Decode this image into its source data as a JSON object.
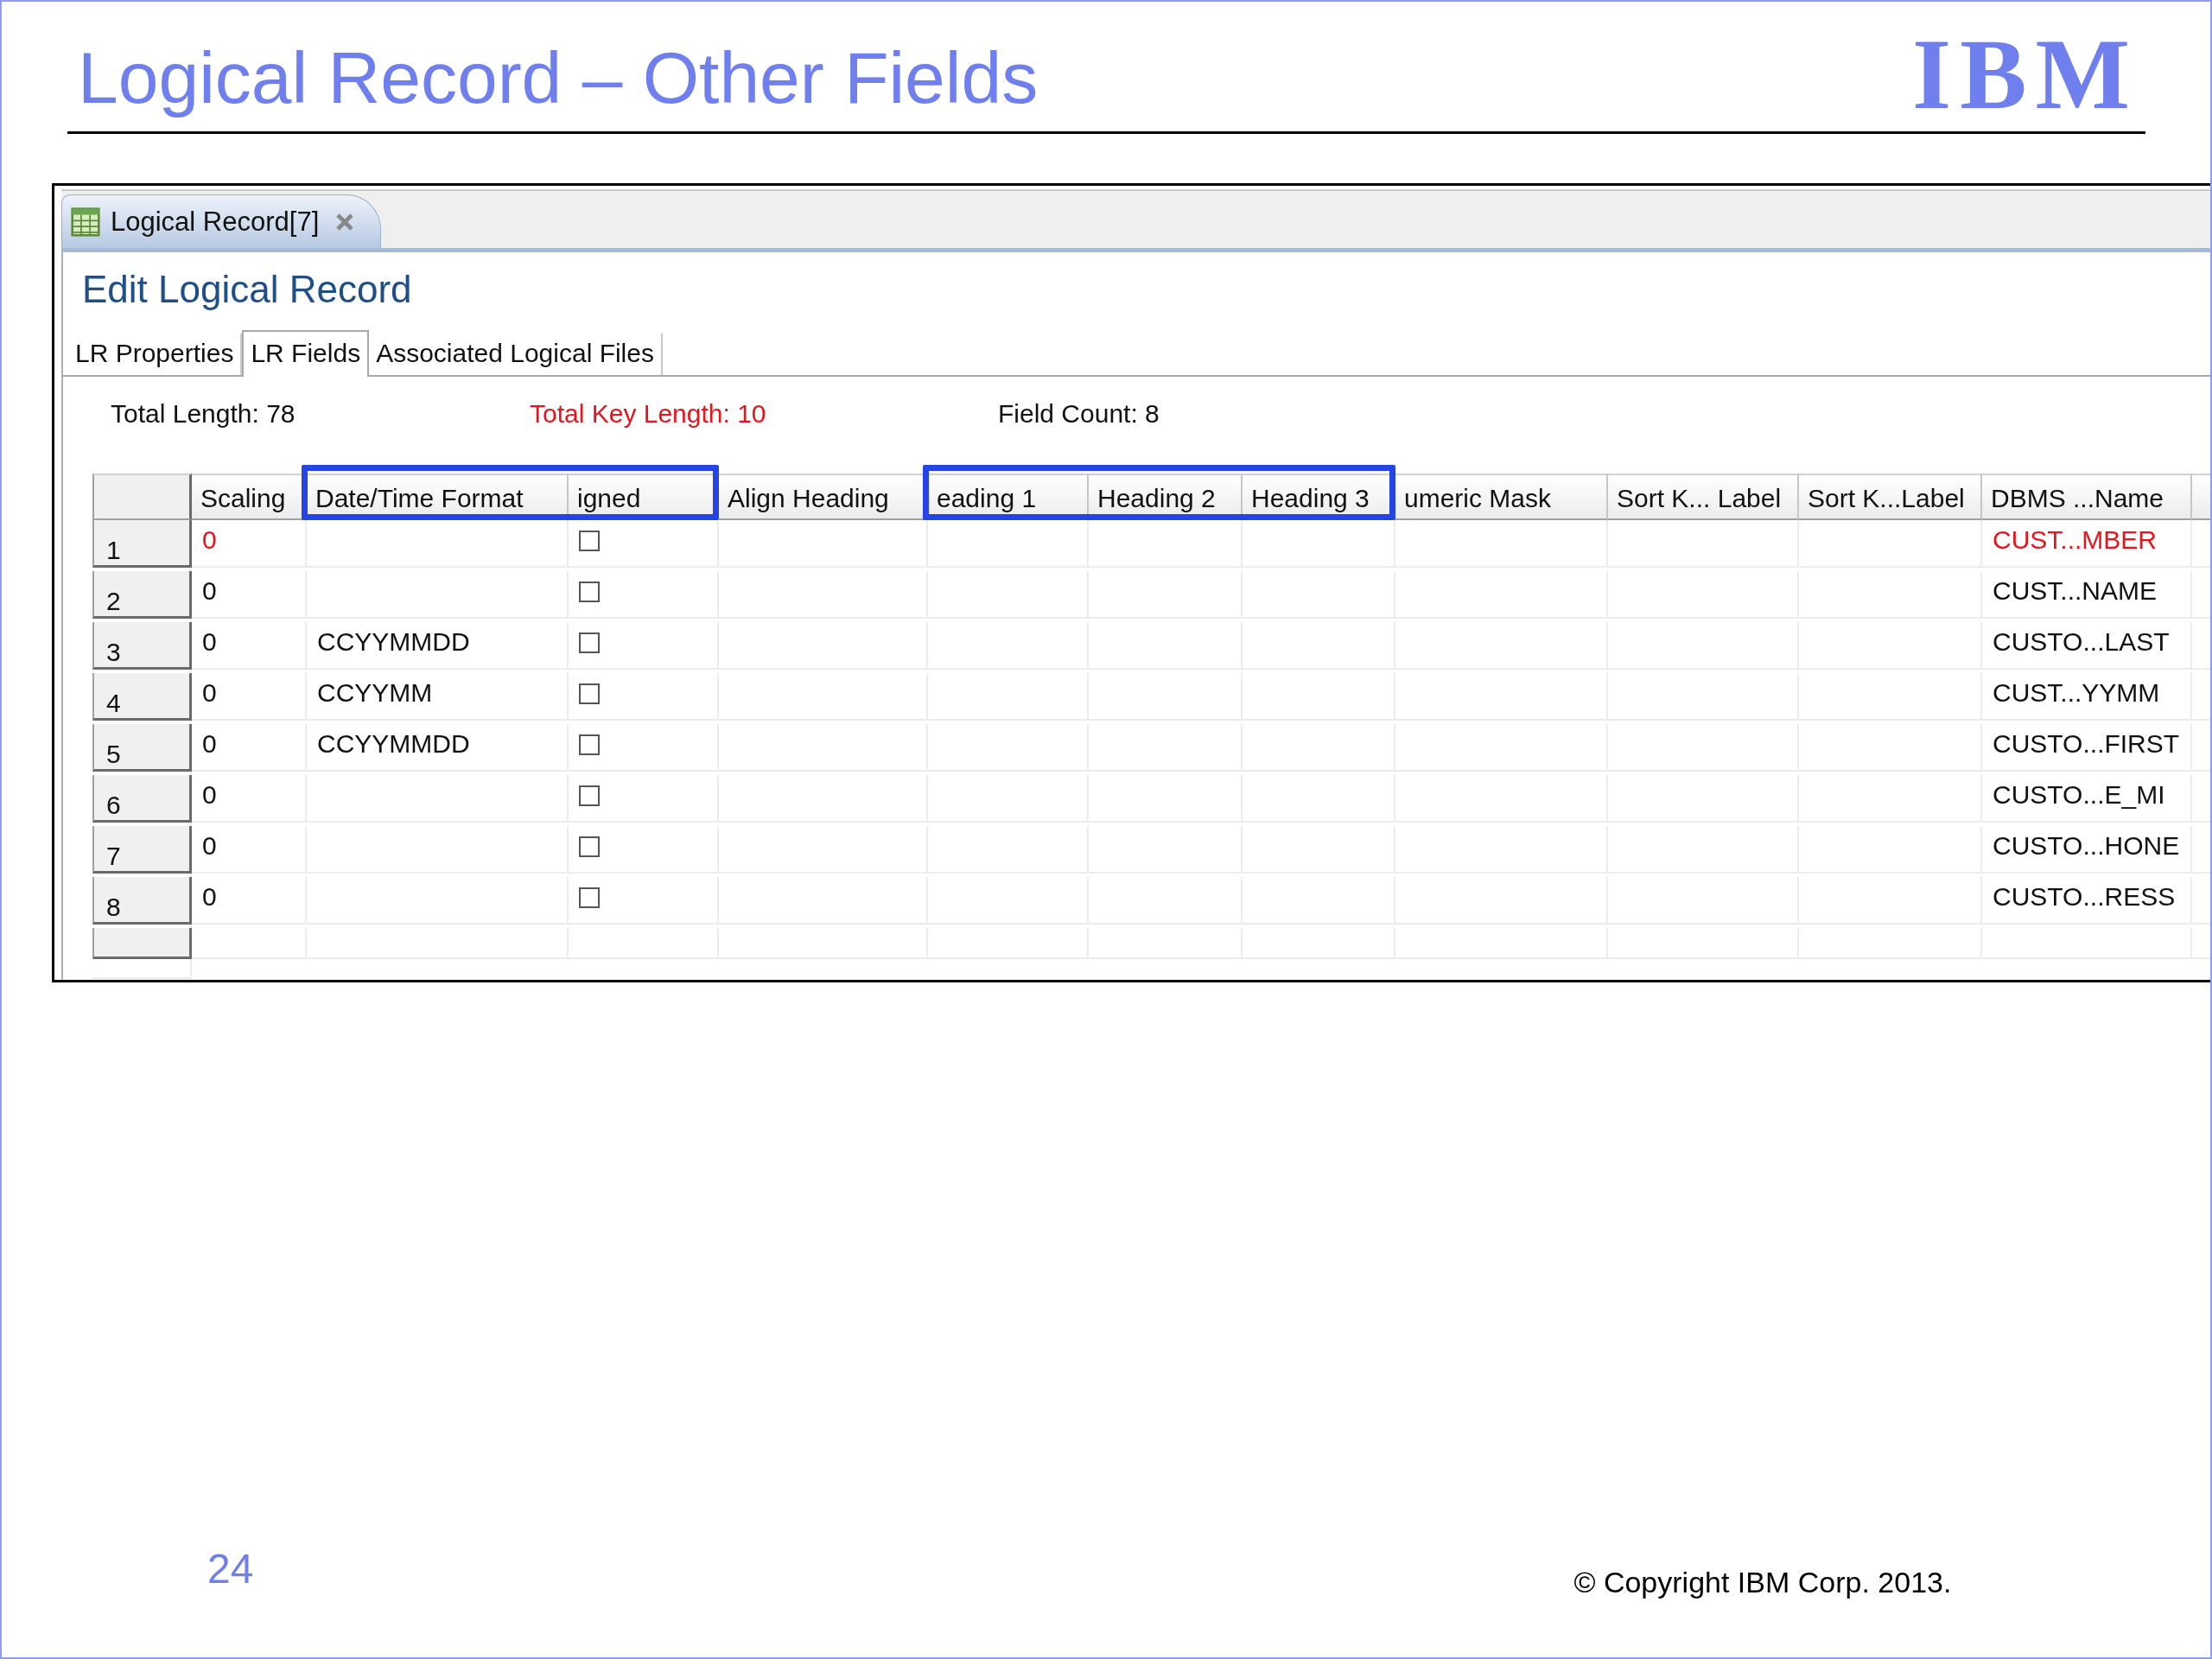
{
  "slide": {
    "title": "Logical Record – Other Fields",
    "logo": "IBM",
    "page_number": "24",
    "copyright": "© Copyright IBM Corp. 2013."
  },
  "editor": {
    "tab": {
      "label": "Logical Record[7]"
    },
    "heading": "Edit Logical Record",
    "tabs": [
      {
        "label": "LR Properties",
        "selected": false
      },
      {
        "label": "LR Fields",
        "selected": true
      },
      {
        "label": "Associated Logical Files",
        "selected": false
      }
    ],
    "summary": [
      {
        "label": "Total Length: 78",
        "alert": false
      },
      {
        "label": "Total Key Length: 10",
        "alert": true
      },
      {
        "label": "Field Count: 8",
        "alert": false
      }
    ],
    "table": {
      "columns": [
        {
          "label": "Scaling",
          "highlighted": false
        },
        {
          "label": "Date/Time Format",
          "highlighted": true
        },
        {
          "label": "igned",
          "highlighted": true
        },
        {
          "label": "Align Heading",
          "highlighted": false
        },
        {
          "label": "eading 1",
          "highlighted": true
        },
        {
          "label": "Heading 2",
          "highlighted": true
        },
        {
          "label": "Heading 3",
          "highlighted": true
        },
        {
          "label": "umeric Mask",
          "highlighted": false
        },
        {
          "label": "Sort K... Label",
          "highlighted": false
        },
        {
          "label": "Sort K...Label",
          "highlighted": false
        },
        {
          "label": "DBMS ...Name",
          "highlighted": false
        }
      ],
      "rows": [
        {
          "number": "1",
          "scaling": "0",
          "signed": false,
          "dbms_name": "CUST...MBER",
          "key": true
        },
        {
          "number": "2",
          "scaling": "0",
          "signed": false,
          "dbms_name": "CUST...NAME",
          "key": false
        },
        {
          "number": "3",
          "scaling": "0",
          "date_time_format": "CCYYMMDD",
          "signed": false,
          "dbms_name": "CUSTO...LAST",
          "key": false
        },
        {
          "number": "4",
          "scaling": "0",
          "date_time_format": "CCYYMM",
          "signed": false,
          "dbms_name": "CUST...YYMM",
          "key": false
        },
        {
          "number": "5",
          "scaling": "0",
          "date_time_format": "CCYYMMDD",
          "signed": false,
          "dbms_name": "CUSTO...FIRST",
          "key": false
        },
        {
          "number": "6",
          "scaling": "0",
          "signed": false,
          "dbms_name": "CUSTO...E_MI",
          "key": false
        },
        {
          "number": "7",
          "scaling": "0",
          "signed": false,
          "dbms_name": "CUSTO...HONE",
          "key": false
        },
        {
          "number": "8",
          "scaling": "0",
          "signed": false,
          "dbms_name": "CUSTO...RESS",
          "key": false
        }
      ]
    }
  }
}
